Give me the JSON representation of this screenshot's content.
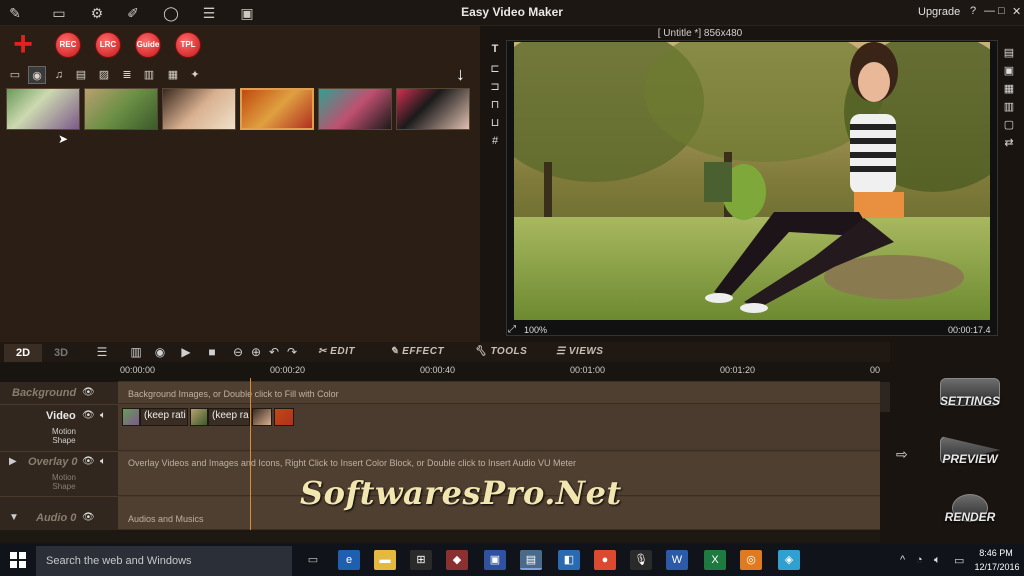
{
  "window": {
    "title": "Easy Video Maker",
    "upgrade_label": "Upgrade",
    "help": "?",
    "minimize": "—",
    "maximize": "□",
    "close": "✕"
  },
  "toolbar_buttons": [
    "REC",
    "LRC",
    "Guide",
    "TPL"
  ],
  "preview": {
    "label": "[ Untitle *]  856x480",
    "zoom": "100%",
    "time": "00:00:17.4"
  },
  "timeline": {
    "mode_tabs": [
      "2D",
      "3D"
    ],
    "menus": [
      "EDIT",
      "EFFECT",
      "TOOLS",
      "VIEWS"
    ],
    "ticks": [
      "00:00:00",
      "00:00:20",
      "00:00:40",
      "00:01:00",
      "00:01:20",
      "00"
    ],
    "tracks": {
      "background": {
        "name": "Background",
        "hint": "Background Images, or Double click to Fill with Color"
      },
      "video": {
        "name": "Video",
        "sub1": "Motion",
        "sub2": "Shape",
        "clip1": "(keep rati",
        "clip2": "(keep ra"
      },
      "overlay": {
        "name": "Overlay 0",
        "sub1": "Motion",
        "sub2": "Shape",
        "hint": "Overlay Videos and Images and Icons, Right Click to Insert Color Block, or Double click to Insert Audio VU Meter"
      },
      "audio": {
        "name": "Audio 0",
        "hint": "Audios and Musics"
      }
    }
  },
  "side_buttons": {
    "settings": "SETTINGS",
    "preview": "PREVIEW",
    "render": "RENDER"
  },
  "watermark": "SoftwaresPro.Net",
  "taskbar": {
    "search_placeholder": "Search the web and Windows",
    "time": "8:46 PM",
    "date": "12/17/2016"
  },
  "colors": {
    "accent_red": "#d62020",
    "playhead": "#e58a2c",
    "panel": "#2a1e15"
  }
}
